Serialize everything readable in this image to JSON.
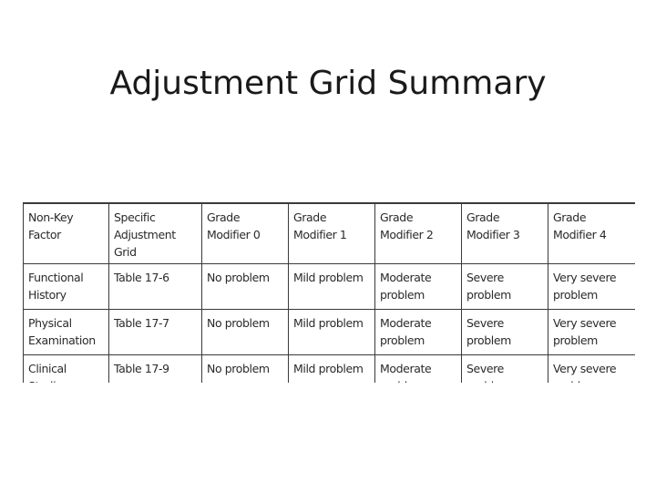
{
  "slide": {
    "title": "Adjustment Grid Summary"
  },
  "table": {
    "headers": [
      [
        "Non-Key",
        "Factor"
      ],
      [
        "Specific",
        "Adjustment Grid"
      ],
      [
        "Grade",
        "Modifier 0"
      ],
      [
        "Grade",
        "Modifier 1"
      ],
      [
        "Grade",
        "Modifier 2"
      ],
      [
        "Grade",
        "Modifier 3"
      ],
      [
        "Grade",
        "Modifier 4"
      ]
    ],
    "rows": [
      {
        "factor": [
          "Functional",
          "History"
        ],
        "grid": "Table 17-6",
        "modifier_0": "No problem",
        "modifier_1": "Mild problem",
        "modifier_2": [
          "Moderate",
          "problem"
        ],
        "modifier_3": [
          "Severe",
          "problem"
        ],
        "modifier_4": [
          "Very severe",
          "problem"
        ]
      },
      {
        "factor": [
          "Physical",
          "Examination"
        ],
        "grid": "Table 17-7",
        "modifier_0": "No problem",
        "modifier_1": "Mild problem",
        "modifier_2": [
          "Moderate",
          "problem"
        ],
        "modifier_3": [
          "Severe",
          "problem"
        ],
        "modifier_4": [
          "Very severe",
          "problem"
        ]
      },
      {
        "factor": [
          "Clinical Studies"
        ],
        "grid": "Table 17-9",
        "modifier_0": "No problem",
        "modifier_1": "Mild problem",
        "modifier_2": [
          "Moderate",
          "problem"
        ],
        "modifier_3": [
          "Severe",
          "problem"
        ],
        "modifier_4": [
          "Very severe",
          "problem"
        ]
      }
    ]
  }
}
